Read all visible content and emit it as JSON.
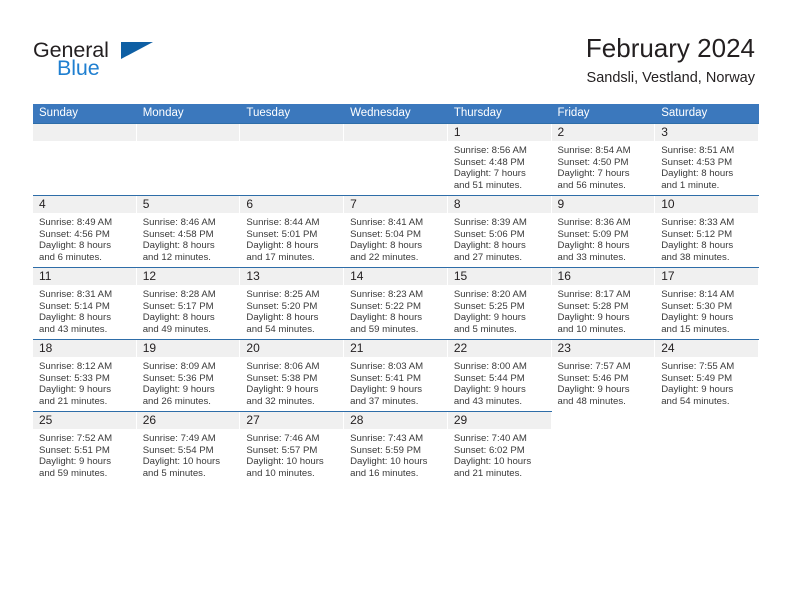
{
  "logo": {
    "text_primary": "General",
    "text_secondary": "Blue",
    "icon": "triangle-icon",
    "color_primary": "#231f20",
    "color_secondary": "#1f7fd0",
    "color_triangle": "#0e5fa4"
  },
  "header": {
    "title": "February 2024",
    "subtitle": "Sandsli, Vestland, Norway"
  },
  "colors": {
    "header_blue": "#3b78bd",
    "week_rule": "#2e6da8",
    "daynum_band": "#f0f0f0",
    "text": "#231f20"
  },
  "calendar": {
    "day_headers": [
      "Sunday",
      "Monday",
      "Tuesday",
      "Wednesday",
      "Thursday",
      "Friday",
      "Saturday"
    ],
    "weeks": [
      {
        "days": [
          {
            "day": "",
            "lines": []
          },
          {
            "day": "",
            "lines": []
          },
          {
            "day": "",
            "lines": []
          },
          {
            "day": "",
            "lines": []
          },
          {
            "day": "1",
            "lines": [
              "Sunrise: 8:56 AM",
              "Sunset: 4:48 PM",
              "Daylight: 7 hours",
              "and 51 minutes."
            ]
          },
          {
            "day": "2",
            "lines": [
              "Sunrise: 8:54 AM",
              "Sunset: 4:50 PM",
              "Daylight: 7 hours",
              "and 56 minutes."
            ]
          },
          {
            "day": "3",
            "lines": [
              "Sunrise: 8:51 AM",
              "Sunset: 4:53 PM",
              "Daylight: 8 hours",
              "and 1 minute."
            ]
          }
        ]
      },
      {
        "days": [
          {
            "day": "4",
            "lines": [
              "Sunrise: 8:49 AM",
              "Sunset: 4:56 PM",
              "Daylight: 8 hours",
              "and 6 minutes."
            ]
          },
          {
            "day": "5",
            "lines": [
              "Sunrise: 8:46 AM",
              "Sunset: 4:58 PM",
              "Daylight: 8 hours",
              "and 12 minutes."
            ]
          },
          {
            "day": "6",
            "lines": [
              "Sunrise: 8:44 AM",
              "Sunset: 5:01 PM",
              "Daylight: 8 hours",
              "and 17 minutes."
            ]
          },
          {
            "day": "7",
            "lines": [
              "Sunrise: 8:41 AM",
              "Sunset: 5:04 PM",
              "Daylight: 8 hours",
              "and 22 minutes."
            ]
          },
          {
            "day": "8",
            "lines": [
              "Sunrise: 8:39 AM",
              "Sunset: 5:06 PM",
              "Daylight: 8 hours",
              "and 27 minutes."
            ]
          },
          {
            "day": "9",
            "lines": [
              "Sunrise: 8:36 AM",
              "Sunset: 5:09 PM",
              "Daylight: 8 hours",
              "and 33 minutes."
            ]
          },
          {
            "day": "10",
            "lines": [
              "Sunrise: 8:33 AM",
              "Sunset: 5:12 PM",
              "Daylight: 8 hours",
              "and 38 minutes."
            ]
          }
        ]
      },
      {
        "days": [
          {
            "day": "11",
            "lines": [
              "Sunrise: 8:31 AM",
              "Sunset: 5:14 PM",
              "Daylight: 8 hours",
              "and 43 minutes."
            ]
          },
          {
            "day": "12",
            "lines": [
              "Sunrise: 8:28 AM",
              "Sunset: 5:17 PM",
              "Daylight: 8 hours",
              "and 49 minutes."
            ]
          },
          {
            "day": "13",
            "lines": [
              "Sunrise: 8:25 AM",
              "Sunset: 5:20 PM",
              "Daylight: 8 hours",
              "and 54 minutes."
            ]
          },
          {
            "day": "14",
            "lines": [
              "Sunrise: 8:23 AM",
              "Sunset: 5:22 PM",
              "Daylight: 8 hours",
              "and 59 minutes."
            ]
          },
          {
            "day": "15",
            "lines": [
              "Sunrise: 8:20 AM",
              "Sunset: 5:25 PM",
              "Daylight: 9 hours",
              "and 5 minutes."
            ]
          },
          {
            "day": "16",
            "lines": [
              "Sunrise: 8:17 AM",
              "Sunset: 5:28 PM",
              "Daylight: 9 hours",
              "and 10 minutes."
            ]
          },
          {
            "day": "17",
            "lines": [
              "Sunrise: 8:14 AM",
              "Sunset: 5:30 PM",
              "Daylight: 9 hours",
              "and 15 minutes."
            ]
          }
        ]
      },
      {
        "days": [
          {
            "day": "18",
            "lines": [
              "Sunrise: 8:12 AM",
              "Sunset: 5:33 PM",
              "Daylight: 9 hours",
              "and 21 minutes."
            ]
          },
          {
            "day": "19",
            "lines": [
              "Sunrise: 8:09 AM",
              "Sunset: 5:36 PM",
              "Daylight: 9 hours",
              "and 26 minutes."
            ]
          },
          {
            "day": "20",
            "lines": [
              "Sunrise: 8:06 AM",
              "Sunset: 5:38 PM",
              "Daylight: 9 hours",
              "and 32 minutes."
            ]
          },
          {
            "day": "21",
            "lines": [
              "Sunrise: 8:03 AM",
              "Sunset: 5:41 PM",
              "Daylight: 9 hours",
              "and 37 minutes."
            ]
          },
          {
            "day": "22",
            "lines": [
              "Sunrise: 8:00 AM",
              "Sunset: 5:44 PM",
              "Daylight: 9 hours",
              "and 43 minutes."
            ]
          },
          {
            "day": "23",
            "lines": [
              "Sunrise: 7:57 AM",
              "Sunset: 5:46 PM",
              "Daylight: 9 hours",
              "and 48 minutes."
            ]
          },
          {
            "day": "24",
            "lines": [
              "Sunrise: 7:55 AM",
              "Sunset: 5:49 PM",
              "Daylight: 9 hours",
              "and 54 minutes."
            ]
          }
        ]
      },
      {
        "partial": true,
        "days": [
          {
            "day": "25",
            "lines": [
              "Sunrise: 7:52 AM",
              "Sunset: 5:51 PM",
              "Daylight: 9 hours",
              "and 59 minutes."
            ]
          },
          {
            "day": "26",
            "lines": [
              "Sunrise: 7:49 AM",
              "Sunset: 5:54 PM",
              "Daylight: 10 hours",
              "and 5 minutes."
            ]
          },
          {
            "day": "27",
            "lines": [
              "Sunrise: 7:46 AM",
              "Sunset: 5:57 PM",
              "Daylight: 10 hours",
              "and 10 minutes."
            ]
          },
          {
            "day": "28",
            "lines": [
              "Sunrise: 7:43 AM",
              "Sunset: 5:59 PM",
              "Daylight: 10 hours",
              "and 16 minutes."
            ]
          },
          {
            "day": "29",
            "lines": [
              "Sunrise: 7:40 AM",
              "Sunset: 6:02 PM",
              "Daylight: 10 hours",
              "and 21 minutes."
            ]
          },
          {
            "day": "",
            "lines": [],
            "blank": true
          },
          {
            "day": "",
            "lines": [],
            "blank": true
          }
        ]
      }
    ]
  }
}
